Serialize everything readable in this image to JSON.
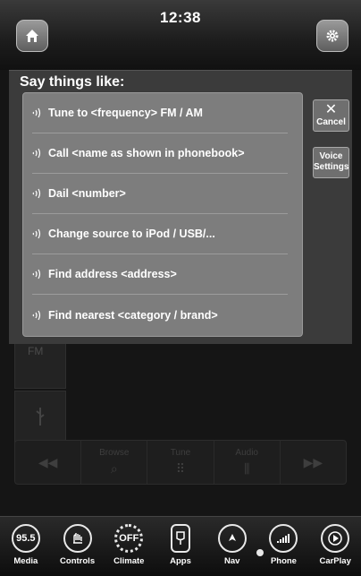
{
  "status": {
    "time": "12:38"
  },
  "voice_prompt": {
    "title": "Say things like:",
    "phrases": [
      "Tune to <frequency> FM / AM",
      "Call <name as shown in phonebook>",
      "Dail <number>",
      "Change source to iPod / USB/...",
      "Find address <address>",
      "Find nearest <category / brand>"
    ],
    "cancel_label": "Cancel",
    "voice_settings_label": "Voice Settings"
  },
  "background_screen": {
    "band_label": "FM",
    "transport_labels": [
      "Browse",
      "Tune",
      "Audio"
    ]
  },
  "dock": {
    "items": [
      {
        "label": "Media",
        "badge": "95.5",
        "icon": "radio-icon"
      },
      {
        "label": "Controls",
        "badge": "",
        "icon": "seat-hand-icon"
      },
      {
        "label": "Climate",
        "badge": "OFF",
        "icon": "climate-icon"
      },
      {
        "label": "Apps",
        "badge": "",
        "icon": "apps-icon"
      },
      {
        "label": "Nav",
        "badge": "",
        "icon": "nav-arrow-icon"
      },
      {
        "label": "Phone",
        "badge": "",
        "icon": "signal-bars-icon"
      },
      {
        "label": "CarPlay",
        "badge": "",
        "icon": "carplay-icon"
      }
    ]
  },
  "colors": {
    "overlay": "#3b3b3b",
    "panel": "#7d7d7d",
    "button": "#6f6f6f"
  }
}
